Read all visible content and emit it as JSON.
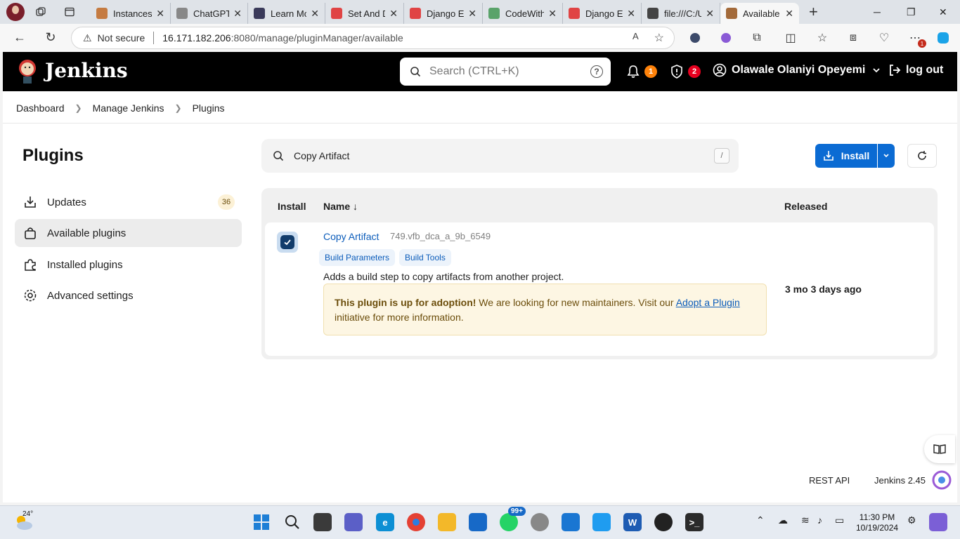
{
  "browser": {
    "tabs": [
      {
        "title": "Instances",
        "color": "#c57b41"
      },
      {
        "title": "ChatGPT",
        "color": "#777777"
      },
      {
        "title": "Learn Mo",
        "color": "#3a3a5a"
      },
      {
        "title": "Set And D",
        "color": "#e04444"
      },
      {
        "title": "Django Ec",
        "color": "#e04444"
      },
      {
        "title": "CodeWith",
        "color": "#5aa36a"
      },
      {
        "title": "Django Ec",
        "color": "#e04444"
      },
      {
        "title": "file:///C:/U",
        "color": "#444444"
      },
      {
        "title": "Available",
        "color": "#a36a3a"
      }
    ],
    "security_label": "Not secure",
    "url_host": "16.171.182.206",
    "url_rest": ":8080/manage/pluginManager/available",
    "ext_badge": "1"
  },
  "header": {
    "brand": "Jenkins",
    "search_placeholder": "Search (CTRL+K)",
    "notif_count": "1",
    "security_count": "2",
    "user_name": "Olawale Olaniyi Opeyemi",
    "logout_label": "log out"
  },
  "breadcrumb": {
    "items": [
      "Dashboard",
      "Manage Jenkins",
      "Plugins"
    ]
  },
  "sidebar": {
    "title": "Plugins",
    "items": [
      {
        "label": "Updates",
        "count": "36"
      },
      {
        "label": "Available plugins"
      },
      {
        "label": "Installed plugins"
      },
      {
        "label": "Advanced settings"
      }
    ]
  },
  "filter": {
    "value": "Copy Artifact",
    "shortcut": "/"
  },
  "actions": {
    "install_label": "Install"
  },
  "table": {
    "col_install": "Install",
    "col_name": "Name ↓",
    "col_released": "Released",
    "row": {
      "name": "Copy Artifact",
      "version": "749.vfb_dca_a_9b_6549",
      "tags": [
        "Build Parameters",
        "Build Tools"
      ],
      "description": "Adds a build step to copy artifacts from another project.",
      "adoption_bold": "This plugin is up for adoption!",
      "adoption_text": " We are looking for new maintainers. Visit our ",
      "adoption_link": "Adopt a Plugin",
      "adoption_tail": " initiative for more information.",
      "released": "3 mo 3 days ago",
      "checked": true
    }
  },
  "footer": {
    "rest_api": "REST API",
    "version": "Jenkins 2.45"
  },
  "taskbar": {
    "temperature": "24°",
    "whatsapp_badge": "99+",
    "time": "11:30 PM",
    "date": "10/19/2024"
  }
}
